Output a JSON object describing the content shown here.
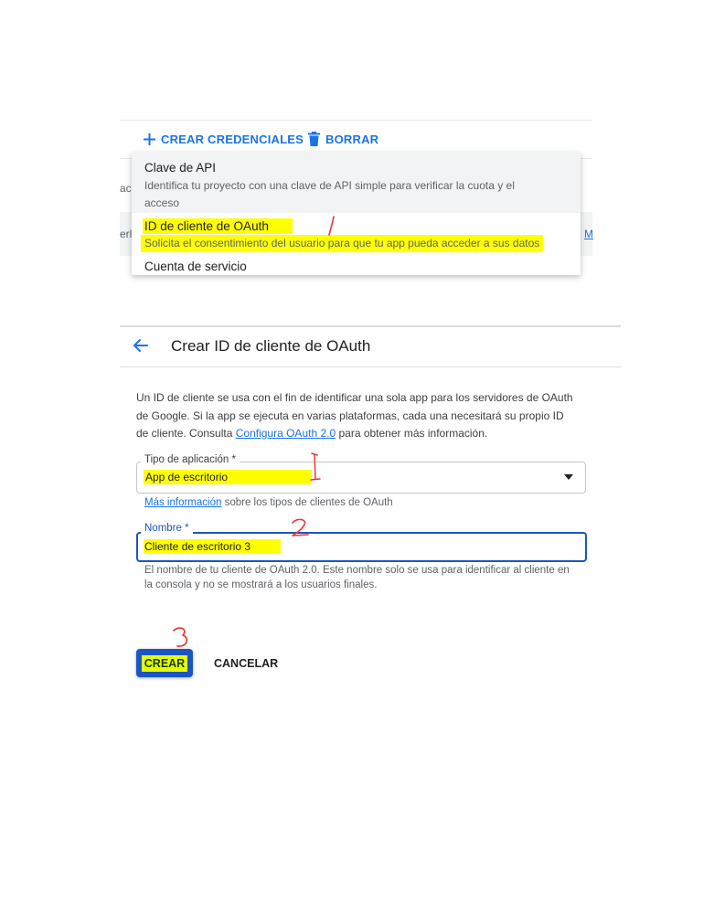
{
  "toolbar": {
    "create_label": "CREAR CREDENCIALES",
    "delete_label": "BORRAR"
  },
  "background_fragments": {
    "row1_prefix": "ac",
    "row2_prefix": "erlo",
    "row2_link": "M"
  },
  "credentials_menu": {
    "items": [
      {
        "title": "Clave de API",
        "desc_line1": "Identifica tu proyecto con una clave de API simple para verificar la cuota y el",
        "desc_line2": "acceso"
      },
      {
        "title": "ID de cliente de OAuth",
        "desc_line1": "Solicita el consentimiento del usuario para que tu app pueda acceder a sus datos"
      },
      {
        "title": "Cuenta de servicio"
      }
    ]
  },
  "create_oauth": {
    "title": "Crear ID de cliente de OAuth",
    "intro_line1": "Un ID de cliente se usa con el fin de identificar una sola app para los servidores de OAuth",
    "intro_line2": "de Google. Si la app se ejecuta en varias plataformas, cada una necesitará su propio ID",
    "intro_line3_pre": "de cliente. Consulta ",
    "intro_link": "Configura OAuth 2.0",
    "intro_line3_post": " para obtener más información.",
    "app_type": {
      "label": "Tipo de aplicación *",
      "value": "App de escritorio",
      "helper_link": "Más información",
      "helper_text": " sobre los tipos de clientes de OAuth"
    },
    "name_field": {
      "label": "Nombre *",
      "value": "Cliente de escritorio 3",
      "helper_line1": "El nombre de tu cliente de OAuth 2.0. Este nombre solo se usa para identificar al cliente en",
      "helper_line2": "la consola y no se mostrará a los usuarios finales."
    },
    "create_button": "CREAR",
    "cancel_button": "CANCELAR"
  },
  "annotations": {
    "step1_menu": "1",
    "step1_field": "1",
    "step2": "2",
    "step3": "3"
  },
  "colors": {
    "accent": "#1a73e8",
    "highlight": "#ffff00",
    "annotation": "#e53935",
    "primary_button": "#1a56c2"
  }
}
